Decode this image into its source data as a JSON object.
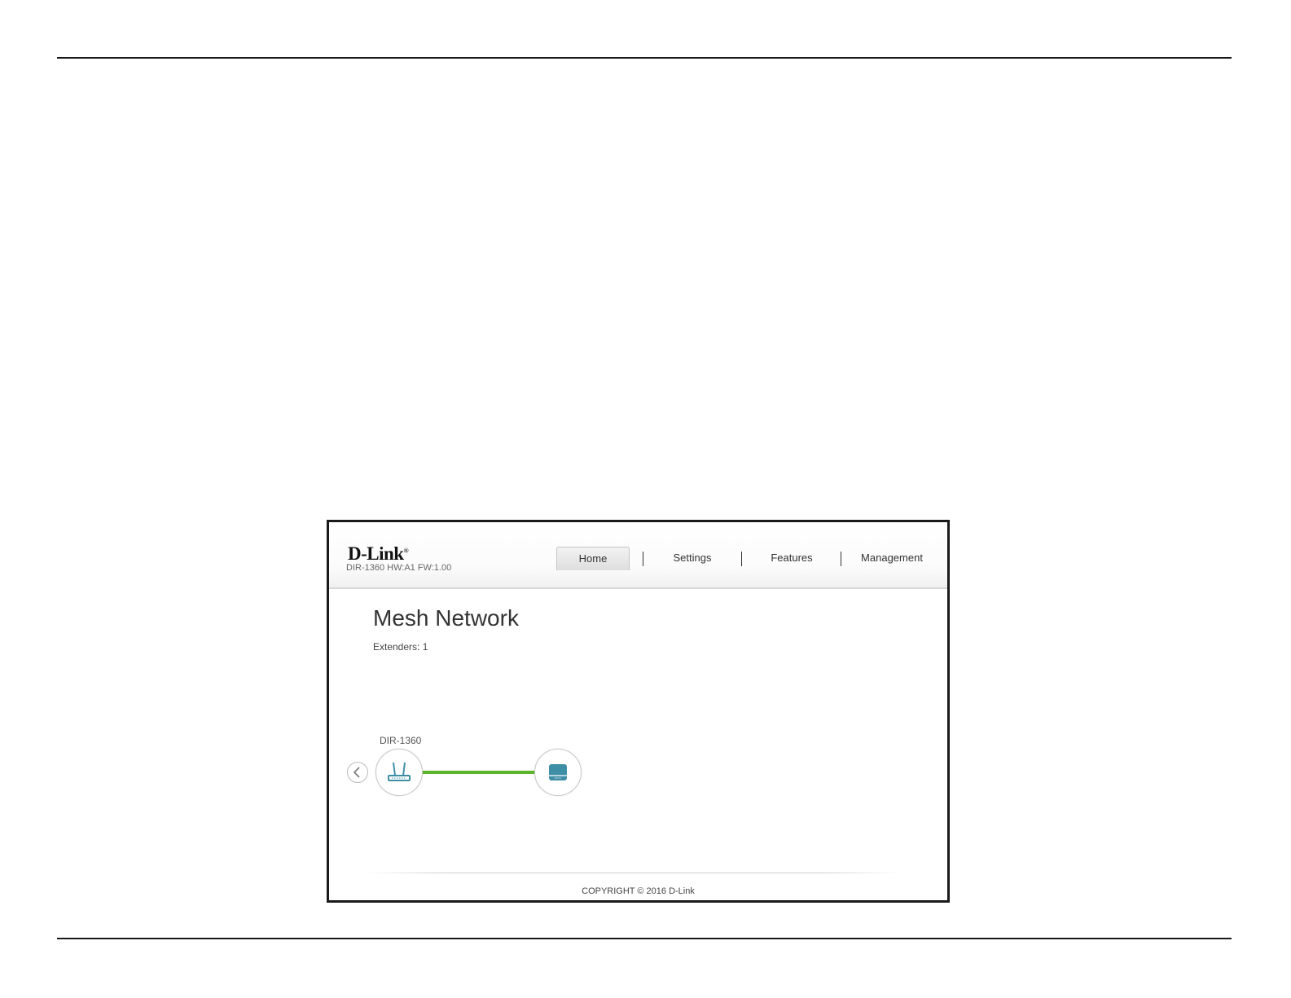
{
  "header": {
    "brand": "D-Link",
    "brand_mark": "®",
    "device_info": "DIR-1360 HW:A1 FW:1.00"
  },
  "nav": {
    "items": [
      {
        "label": "Home",
        "active": true
      },
      {
        "label": "Settings",
        "active": false
      },
      {
        "label": "Features",
        "active": false
      },
      {
        "label": "Management",
        "active": false
      }
    ]
  },
  "main": {
    "title": "Mesh Network",
    "extenders": "Extenders: 1"
  },
  "mesh": {
    "router_label": "DIR-1360",
    "link_color": "#5cb52b",
    "router_icon": "router-icon",
    "extender_icon": "extender-icon",
    "prev_icon": "chevron-left-icon"
  },
  "footer": {
    "copyright": "COPYRIGHT © 2016 D-Link"
  },
  "colors": {
    "icon_teal": "#3e8fa6",
    "active_tab": "#e6e6e6"
  }
}
